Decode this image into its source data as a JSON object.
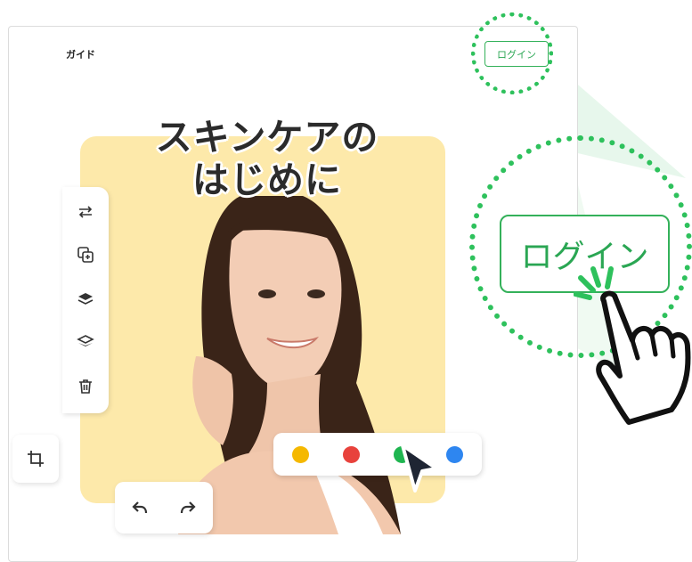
{
  "header": {
    "nav_label": "ガイド",
    "login_button_label": "ログイン"
  },
  "callout": {
    "login_button_label": "ログイン"
  },
  "canvas": {
    "title_line1": "スキンケアの",
    "title_line2": "はじめに"
  },
  "toolbar": {
    "tools": [
      "swap-icon",
      "duplicate-icon",
      "bring-forward-icon",
      "send-backward-icon",
      "delete-icon"
    ]
  },
  "bottom_tools": [
    "crop-icon",
    "undo-icon",
    "redo-icon"
  ],
  "color_picker": {
    "colors": [
      "#f5b800",
      "#e8423c",
      "#1fb550",
      "#2e86f0"
    ],
    "selected": "#1fb550"
  },
  "accent_color": "#2ec15c"
}
